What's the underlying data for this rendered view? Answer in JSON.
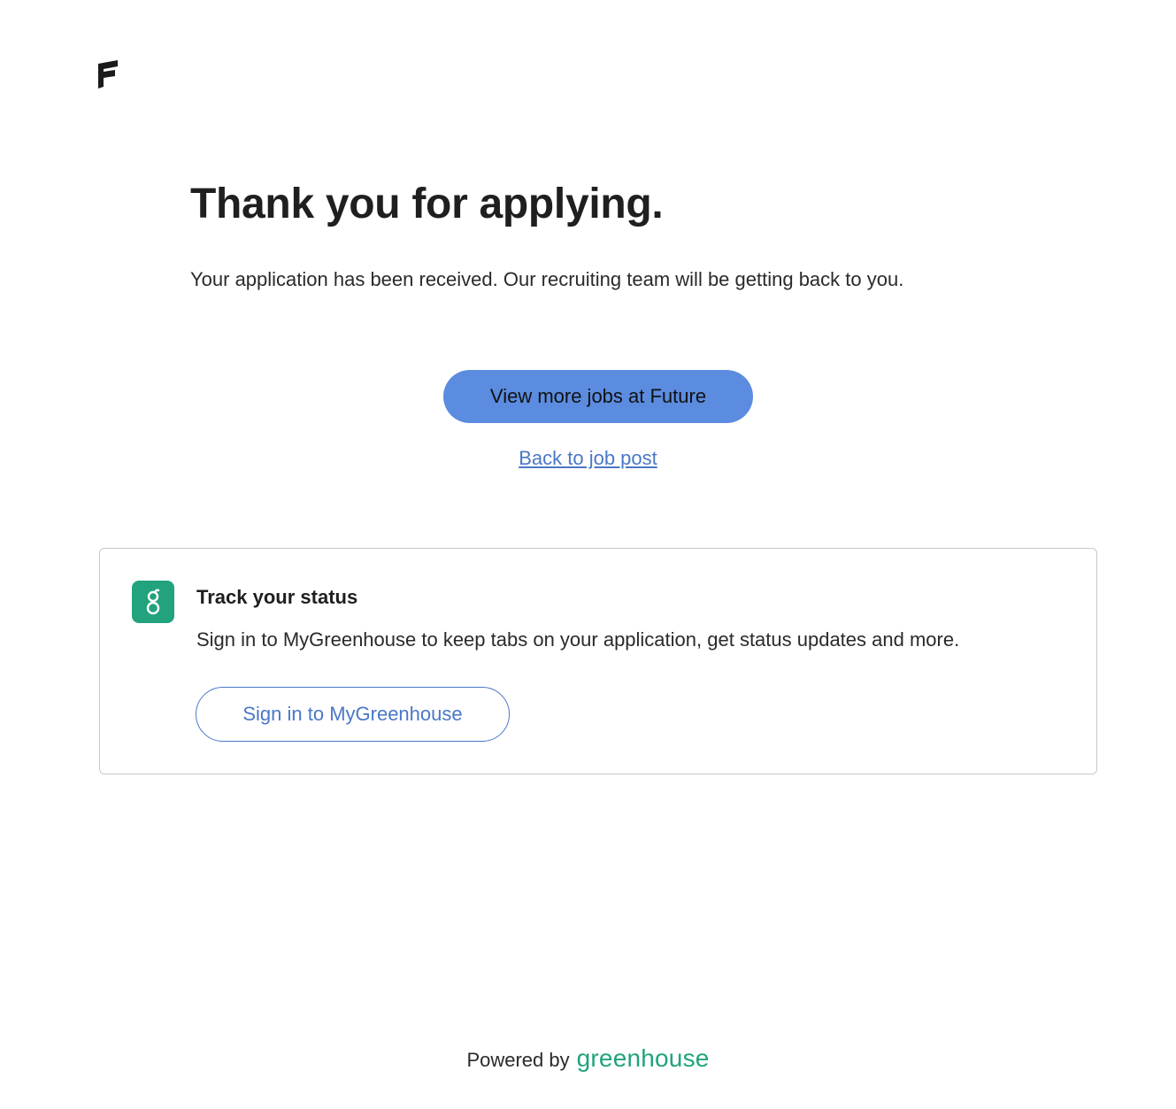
{
  "header": {
    "logo_icon": "future-f-logo-icon"
  },
  "main": {
    "title": "Thank you for applying.",
    "subtitle": "Your application has been received. Our recruiting team will be getting back to you.",
    "primary_button": "View more jobs at Future",
    "back_link": "Back to job post"
  },
  "status_card": {
    "icon": "greenhouse-g-icon",
    "title": "Track your status",
    "text": "Sign in to MyGreenhouse to keep tabs on your application, get status updates and more.",
    "button": "Sign in to MyGreenhouse"
  },
  "footer": {
    "powered_by": "Powered by",
    "brand": "greenhouse"
  },
  "colors": {
    "primary": "#5b8ce0",
    "link": "#4a78c7",
    "greenhouse_green": "#22a37d"
  }
}
